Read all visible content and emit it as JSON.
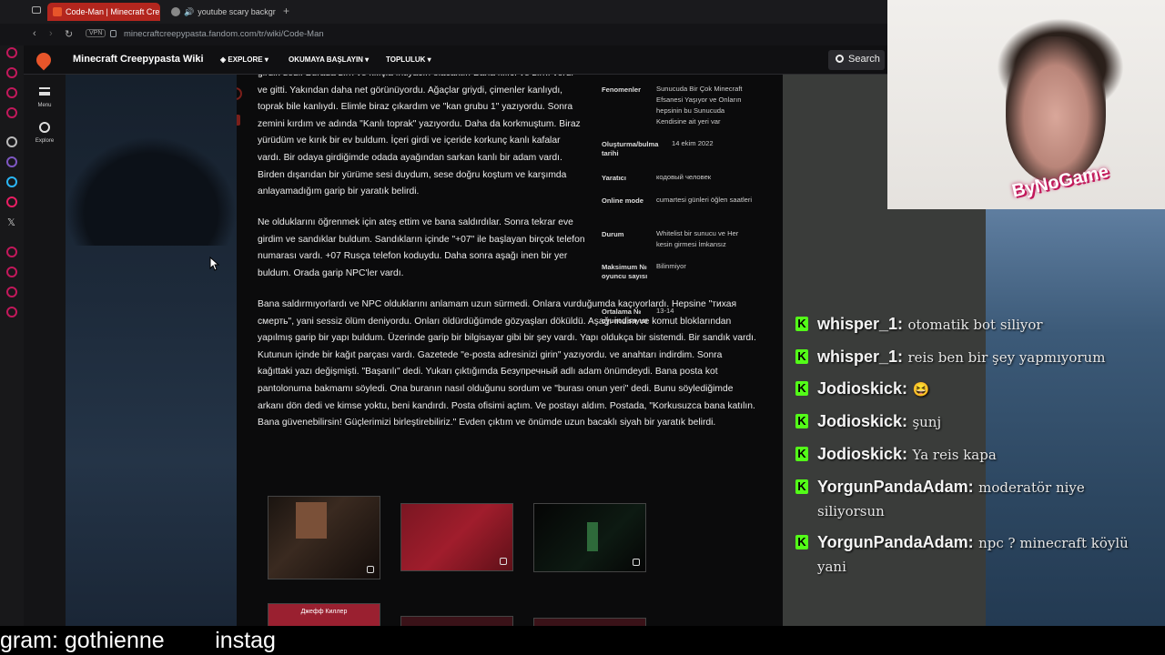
{
  "browser": {
    "tabs": [
      {
        "label": "Code-Man | Minecraft Cre",
        "active": true
      },
      {
        "label": "youtube scary backgr",
        "active": false
      }
    ],
    "new_tab": "+",
    "vpn": "VPN",
    "url": "minecraftcreepypasta.fandom.com/tr/wiki/Code-Man"
  },
  "wiki": {
    "title": "Minecraft Creepypasta Wiki",
    "menus": [
      "EXPLORE",
      "OKUMAYA BAŞLAYIN",
      "TOPLULUK"
    ],
    "search_label": "Search",
    "rail": {
      "menu": "Menu",
      "explore": "Explore"
    }
  },
  "article": {
    "paragraphs": [
      "girdik dedi. Burada zırh ve kılıçla ıntiyacın olacaktır. Bana kılıcı ve zırhı verdi ve gitti. Yakından daha net görünüyordu. Ağaçlar griydi, çimenler kanlıydı, toprak bile kanlıydı. Elimle biraz çıkardım ve \"kan grubu 1\" yazıyordu. Sonra zemini kırdım ve adında \"Kanlı toprak\" yazıyordu. Daha da korkmuştum. Biraz yürüdüm ve kırık bir ev buldum. İçeri girdi ve içeride korkunç kanlı kafalar vardı. Bir odaya girdiğimde odada ayağından sarkan kanlı bir adam vardı. Birden dışarıdan bir yürüme sesi duydum, sese doğru koştum ve karşımda anlayamadığım garip bir yaratık belirdi.",
      "Ne olduklarını öğrenmek için ateş ettim ve bana saldırdılar. Sonra tekrar eve girdim ve sandıklar buldum. Sandıkların içinde \"+07\" ile başlayan birçok telefon numarası vardı. +07 Rusça telefon koduydu. Daha sonra aşağı inen bir yer buldum. Orada garip NPC'ler vardı.",
      "Bana saldırmıyorlardı ve NPC olduklarını anlamam uzun sürmedi. Onlara vurduğumda kaçıyorlardı. Hepsine \"тихая смерть\", yani sessiz ölüm deniyordu. Onları öldürdüğümde gözyaşları döküldü. Aşağı indim ve komut bloklarından yapılmış garip bir yapı buldum. Üzerinde garip bir bilgisayar gibi bir şey vardı. Yapı oldukça bir sistemdi. Bir sandık vardı. Kutunun içinde bir kağıt parçası vardı. Gazetede \"e-posta adresinizi girin\" yazıyordu. ve anahtarı indirdim. Sonra kağıttaki yazı değişmişti. \"Başarılı\" dedi. Yukarı çıktığımda Безупречный adlı adam önümdeydi. Bana posta kot pantolonuma bakmamı söyledi. Ona buranın nasıl olduğunu sordum ve \"burası onun yeri\" dedi. Bunu söylediğimde arkanı dön dedi ve kimse yoktu, beni kandırdı. Posta ofisimi açtım. Ve postayı aldım. Postada, \"Korkusuzca bana katılın. Bana güvenebilirsin! Güçlerimizi birleştirebiliriz.\" Evden çıktım ve önümde uzun bacaklı siyah bir yaratık belirdi."
    ],
    "infobox": [
      {
        "label": "Fenomenler",
        "value": "Sunucuda Bir Çok Minecraft Efsanesi Yaşıyor ve Onların hepsinin bu Sunucuda Kendisine ait yeri var"
      },
      {
        "label": "Oluşturma/bulma tarihi",
        "value": "14 ekim 2022"
      },
      {
        "label": "Yaratıcı",
        "value": "кодовый человек"
      },
      {
        "label": "Online mode",
        "value": "cumartesi günleri öğlen saatleri"
      },
      {
        "label": "Durum",
        "value": "Whitelist bir sunucu ve Her kesin girmesi İmkansız"
      },
      {
        "label": "Maksimum № oyuncu sayısı",
        "value": "Bilinmiyor"
      },
      {
        "label": "Ortalama № oyuncu sayısı",
        "value": "13-14"
      }
    ],
    "gallery_caption": "Джефф Киллер"
  },
  "overlay": {
    "watermark": "ByNoGame",
    "ticker": "gram: gothienne        instag"
  },
  "chat": [
    {
      "badge": "K",
      "user": "whisper_1:",
      "message": "otomatik bot siliyor"
    },
    {
      "badge": "K",
      "user": "whisper_1:",
      "message": "reis ben bir şey yapmıyorum"
    },
    {
      "badge": "K",
      "user": "Jodioskick:",
      "message": "😆"
    },
    {
      "badge": "K",
      "user": "Jodioskick:",
      "message": "şunj"
    },
    {
      "badge": "K",
      "user": "Jodioskick:",
      "message": "Ya reis kapa"
    },
    {
      "badge": "K",
      "user": "YorgunPandaAdam:",
      "message": "moderatör niye siliyorsun"
    },
    {
      "badge": "K",
      "user": "YorgunPandaAdam:",
      "message": "npc ? minecraft köylü yani"
    }
  ],
  "colors": {
    "accent": "#b3261e",
    "kick": "#53fc18",
    "fandom": "#e8552a"
  }
}
